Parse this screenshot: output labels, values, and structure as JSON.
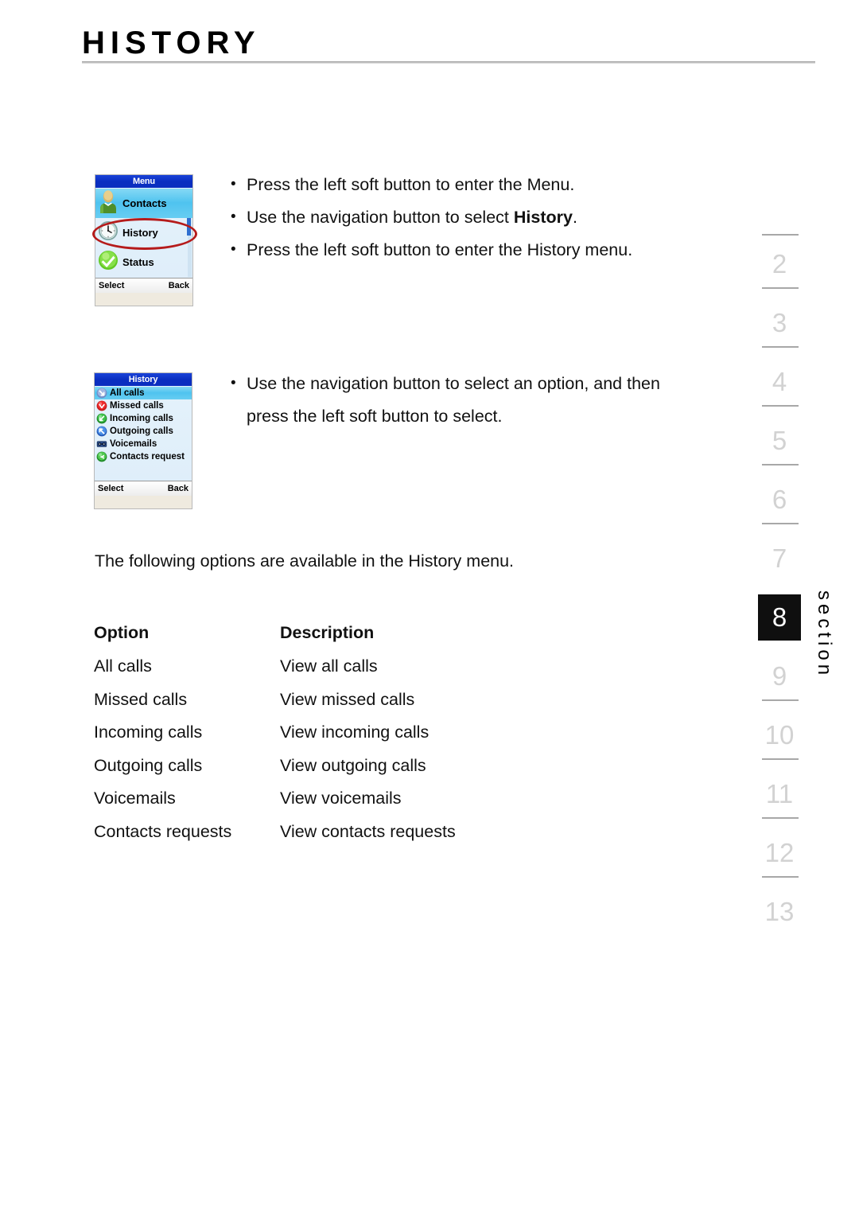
{
  "page": {
    "title": "HISTORY"
  },
  "phone_menu": {
    "screen_title": "Menu",
    "items": [
      {
        "label": "Contacts",
        "icon": "contact-person-icon",
        "selected": true
      },
      {
        "label": "History",
        "icon": "clock-icon",
        "selected": false,
        "highlighted": true
      },
      {
        "label": "Status",
        "icon": "green-check-icon",
        "selected": false
      }
    ],
    "softkeys": {
      "left": "Select",
      "right": "Back"
    }
  },
  "phone_history": {
    "screen_title": "History",
    "items": [
      {
        "label": "All calls",
        "icon": "all-calls-icon",
        "selected": true
      },
      {
        "label": "Missed calls",
        "icon": "missed-calls-icon",
        "selected": false
      },
      {
        "label": "Incoming calls",
        "icon": "incoming-calls-icon",
        "selected": false
      },
      {
        "label": "Outgoing calls",
        "icon": "outgoing-calls-icon",
        "selected": false
      },
      {
        "label": "Voicemails",
        "icon": "voicemail-icon",
        "selected": false
      },
      {
        "label": "Contacts request",
        "icon": "contacts-request-icon",
        "selected": false
      }
    ],
    "softkeys": {
      "left": "Select",
      "right": "Back"
    }
  },
  "instructions_menu": [
    {
      "text": "Press the left soft button to enter the Menu."
    },
    {
      "text_before": "Use the navigation button to select ",
      "bold": "History",
      "text_after": "."
    },
    {
      "text": "Press the left soft button to enter the History menu."
    }
  ],
  "instructions_history": [
    {
      "text": "Use the navigation button to select an option, and then press the left soft button to select."
    }
  ],
  "intro_paragraph": "The following options are available in the History menu.",
  "options_table": {
    "headers": {
      "option": "Option",
      "description": "Description"
    },
    "rows": [
      {
        "option": "All calls",
        "description": "View all calls"
      },
      {
        "option": "Missed calls",
        "description": "View missed calls"
      },
      {
        "option": "Incoming calls",
        "description": "View incoming calls"
      },
      {
        "option": "Outgoing calls",
        "description": "View outgoing calls"
      },
      {
        "option": "Voicemails",
        "description": "View voicemails"
      },
      {
        "option": "Contacts requests",
        "description": "View contacts requests"
      }
    ]
  },
  "section_rail": {
    "word": "section",
    "active": "8",
    "numbers": [
      "2",
      "3",
      "4",
      "5",
      "6",
      "7",
      "8",
      "9",
      "10",
      "11",
      "12",
      "13"
    ]
  },
  "colors": {
    "phone_titlebar_blue": "#0a2ec0",
    "phone_selected_cyan": "#4fc3ef",
    "highlight_red": "#b51b1b",
    "rail_active_bg": "#0f0f0f",
    "rail_number_gray": "#d2d2d2"
  }
}
